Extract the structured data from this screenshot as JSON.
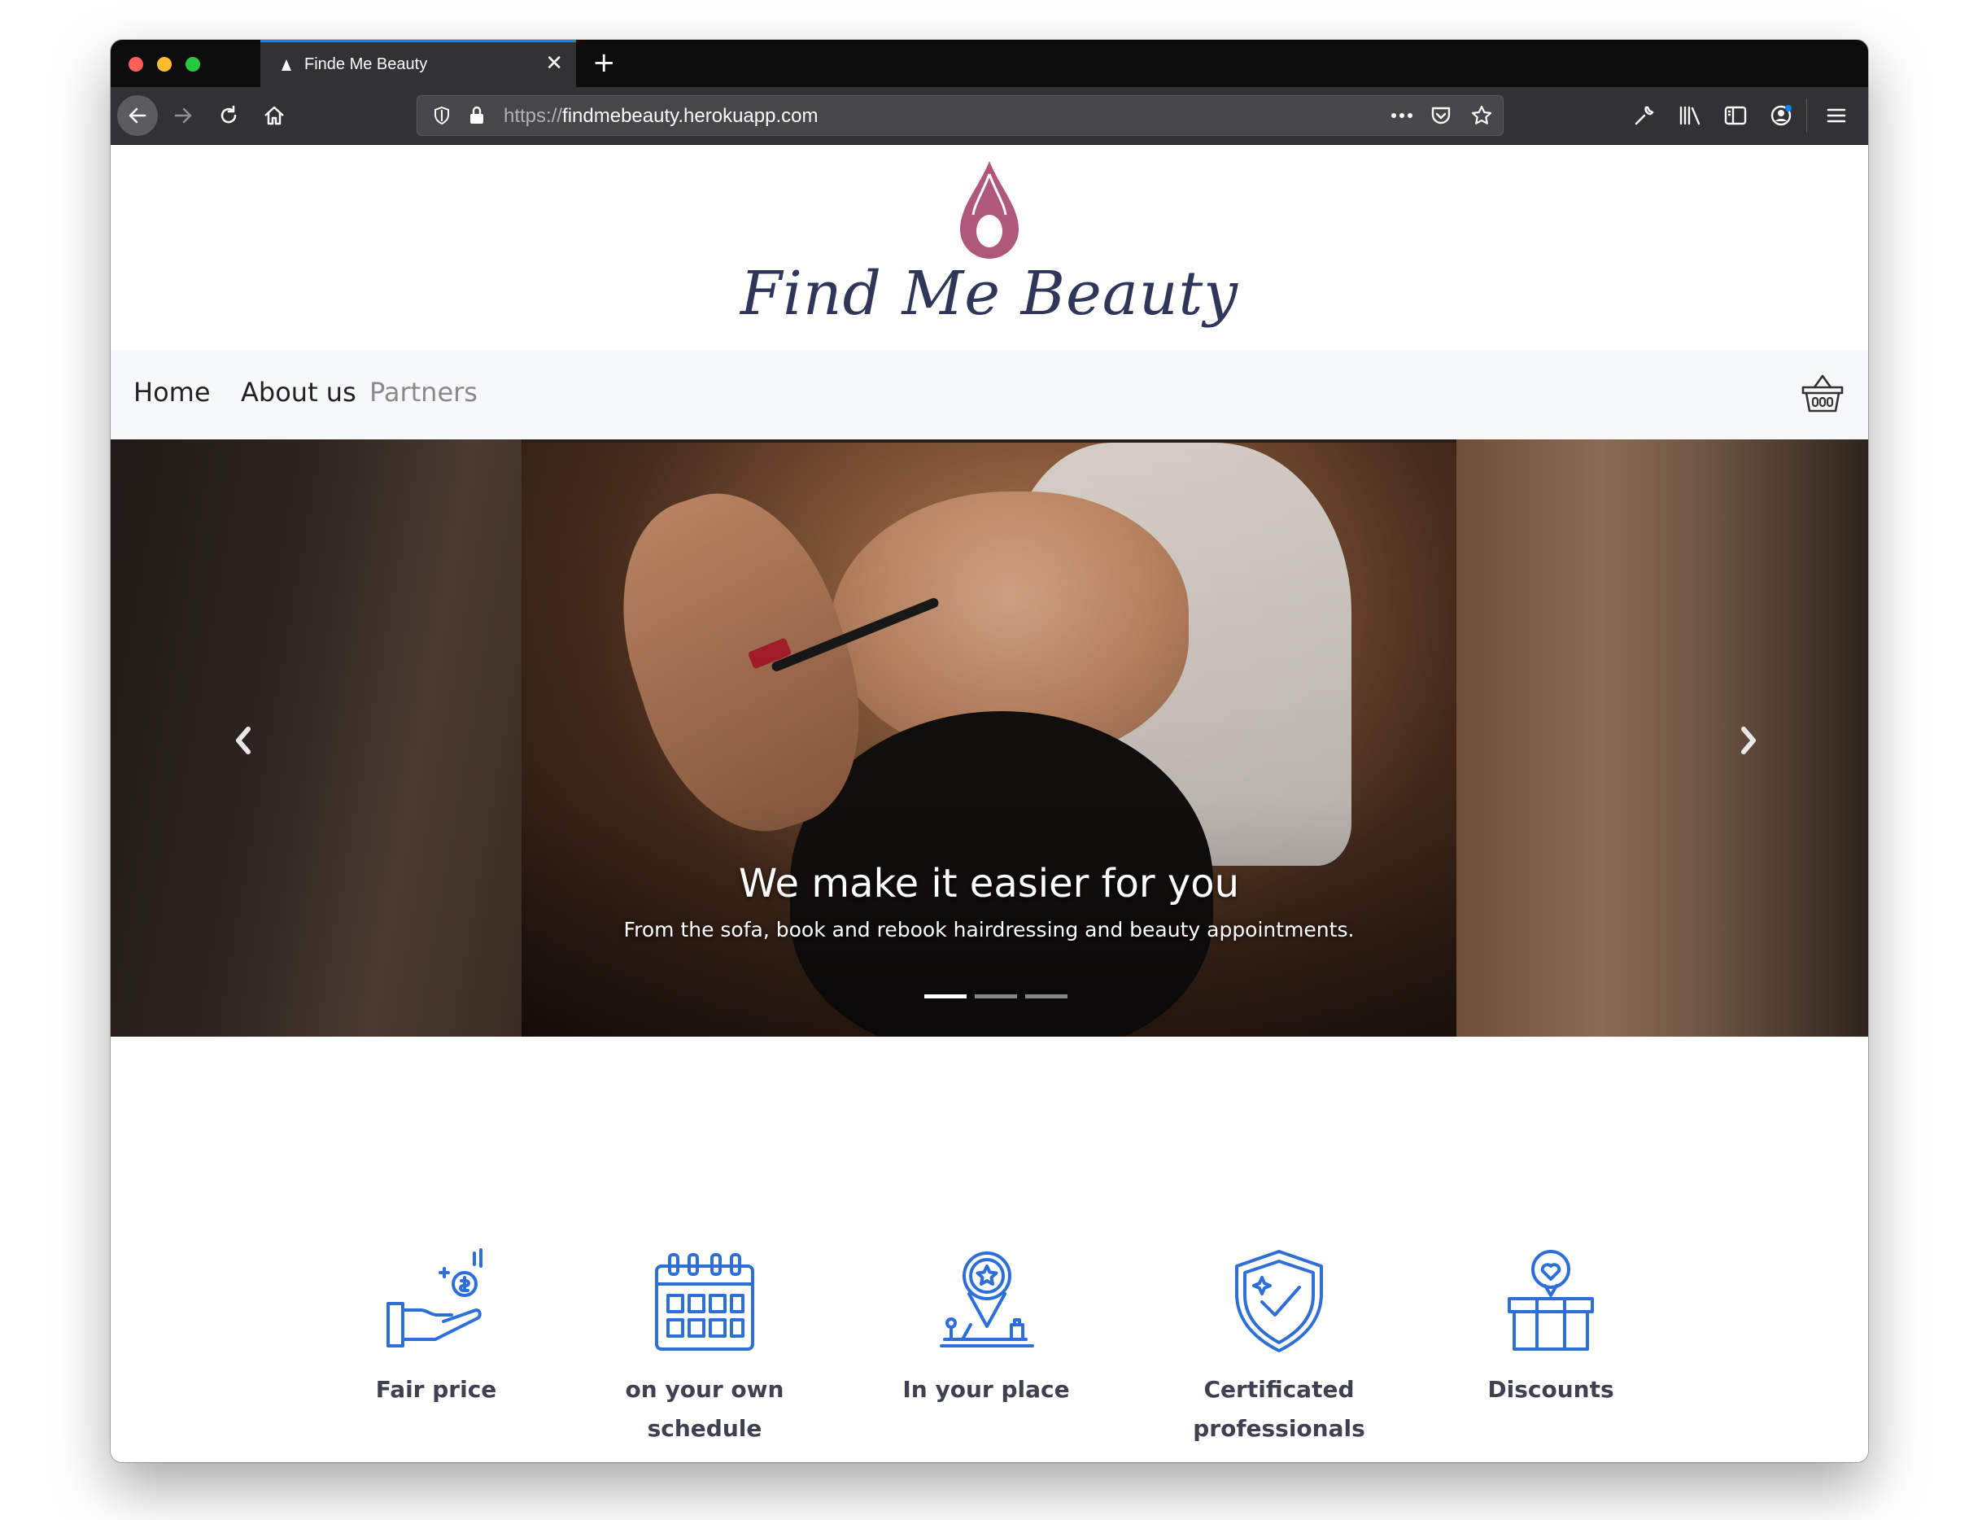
{
  "browser": {
    "tab_title": "Finde Me Beauty",
    "new_tab_symbol": "+",
    "close_symbol": "✕",
    "url_scheme": "https://",
    "url_host": "findmebeauty.herokuapp.com",
    "icons": [
      "back-arrow-icon",
      "forward-arrow-icon",
      "reload-icon",
      "home-icon",
      "shield-icon",
      "lock-icon",
      "more-icon",
      "pocket-icon",
      "star-icon",
      "wrench-icon",
      "library-icon",
      "sidebar-icon",
      "account-icon",
      "menu-icon"
    ]
  },
  "site": {
    "title": "Find Me Beauty",
    "logo_icon": "droplet-logo-icon",
    "brand_color": "#b0587c",
    "title_color": "#2f3659"
  },
  "nav": {
    "items": [
      {
        "label": "Home"
      },
      {
        "label": "About us"
      },
      {
        "label": "Partners"
      }
    ],
    "cart_icon": "basket-icon"
  },
  "carousel": {
    "title": "We make it easier for you",
    "subtitle": "From the sofa, book and rebook hairdressing and beauty appointments.",
    "slide_count": 3,
    "active_slide": 1
  },
  "features": {
    "icon_color": "#2d6fd6",
    "items": [
      {
        "label": "Fair price",
        "icon": "hand-coin-icon"
      },
      {
        "label": "on your own schedule",
        "icon": "calendar-icon"
      },
      {
        "label": "In your place",
        "icon": "location-pin-icon"
      },
      {
        "label": "Certificated professionals",
        "icon": "shield-check-icon"
      },
      {
        "label": "Discounts",
        "icon": "gift-icon"
      }
    ]
  }
}
